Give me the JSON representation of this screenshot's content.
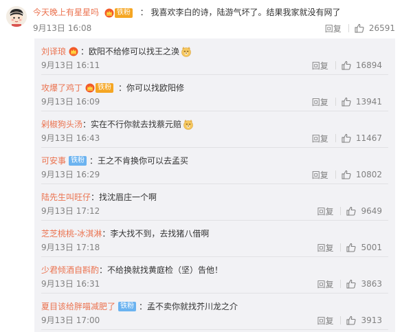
{
  "main_comment": {
    "user": "今天晚上有星星吗",
    "badge_text": "铁粉",
    "text": "我喜欢李白的诗，陆游气坏了。结果我家就没有网了",
    "time": "9月13日 16:08",
    "reply_label": "回复",
    "likes": "26591"
  },
  "replies": [
    {
      "user": "刘译琅",
      "badge": "vip",
      "badge_text": "",
      "text": "欧阳不给修可以找王之涣",
      "emoji": "dog-face-emoji",
      "time": "9月13日 16:11",
      "reply_label": "回复",
      "likes": "16894"
    },
    {
      "user": "攻爆了鸡丁",
      "badge": "vip-tie",
      "badge_text": "铁粉",
      "text": "你可以找欧阳修",
      "emoji": "",
      "time": "9月13日 16:09",
      "reply_label": "回复",
      "likes": "13941"
    },
    {
      "user": "剁椒狗头汤",
      "badge": "",
      "badge_text": "",
      "text": "实在不行你就去找蔡元赔",
      "emoji": "dog-face-emoji",
      "time": "9月13日 16:43",
      "reply_label": "回复",
      "likes": "11467"
    },
    {
      "user": "可安事",
      "badge": "tie",
      "badge_text": "铁粉",
      "text": "王之不肯换你可以去孟买",
      "emoji": "",
      "time": "9月13日 16:29",
      "reply_label": "回复",
      "likes": "10802"
    },
    {
      "user": "陆先生叫旺仔",
      "badge": "",
      "badge_text": "",
      "text": "找沈眉庄一个啊",
      "emoji": "",
      "time": "9月13日 17:12",
      "reply_label": "回复",
      "likes": "9649"
    },
    {
      "user": "芝芝桃桃-冰淇淋",
      "badge": "",
      "badge_text": "",
      "text": "李大找不到，去找猪八借啊",
      "emoji": "",
      "time": "9月13日 17:18",
      "reply_label": "回复",
      "likes": "5001"
    },
    {
      "user": "少君倾酒自斟酌",
      "badge": "",
      "badge_text": "",
      "text": "不给换就找黄庭检（坚）告他！",
      "emoji": "",
      "time": "9月13日 16:31",
      "reply_label": "回复",
      "likes": "3863"
    },
    {
      "user": "夏目该给胖喵减肥了",
      "badge": "tie",
      "badge_text": "铁粉",
      "text": "孟不卖你就找芥川龙之介",
      "emoji": "",
      "time": "9月13日 17:00",
      "reply_label": "回复",
      "likes": "3913"
    }
  ],
  "colors": {
    "username": "#eb7350",
    "meta": "#808080",
    "reply_panel_bg": "#f2f2f5",
    "badge_blue": "#6bb3f0",
    "badge_gold": "#f5a623"
  },
  "icons": {
    "like": "thumbs-up-icon",
    "vip": "vip-crown-icon",
    "emoji": "dog-face-emoji"
  }
}
